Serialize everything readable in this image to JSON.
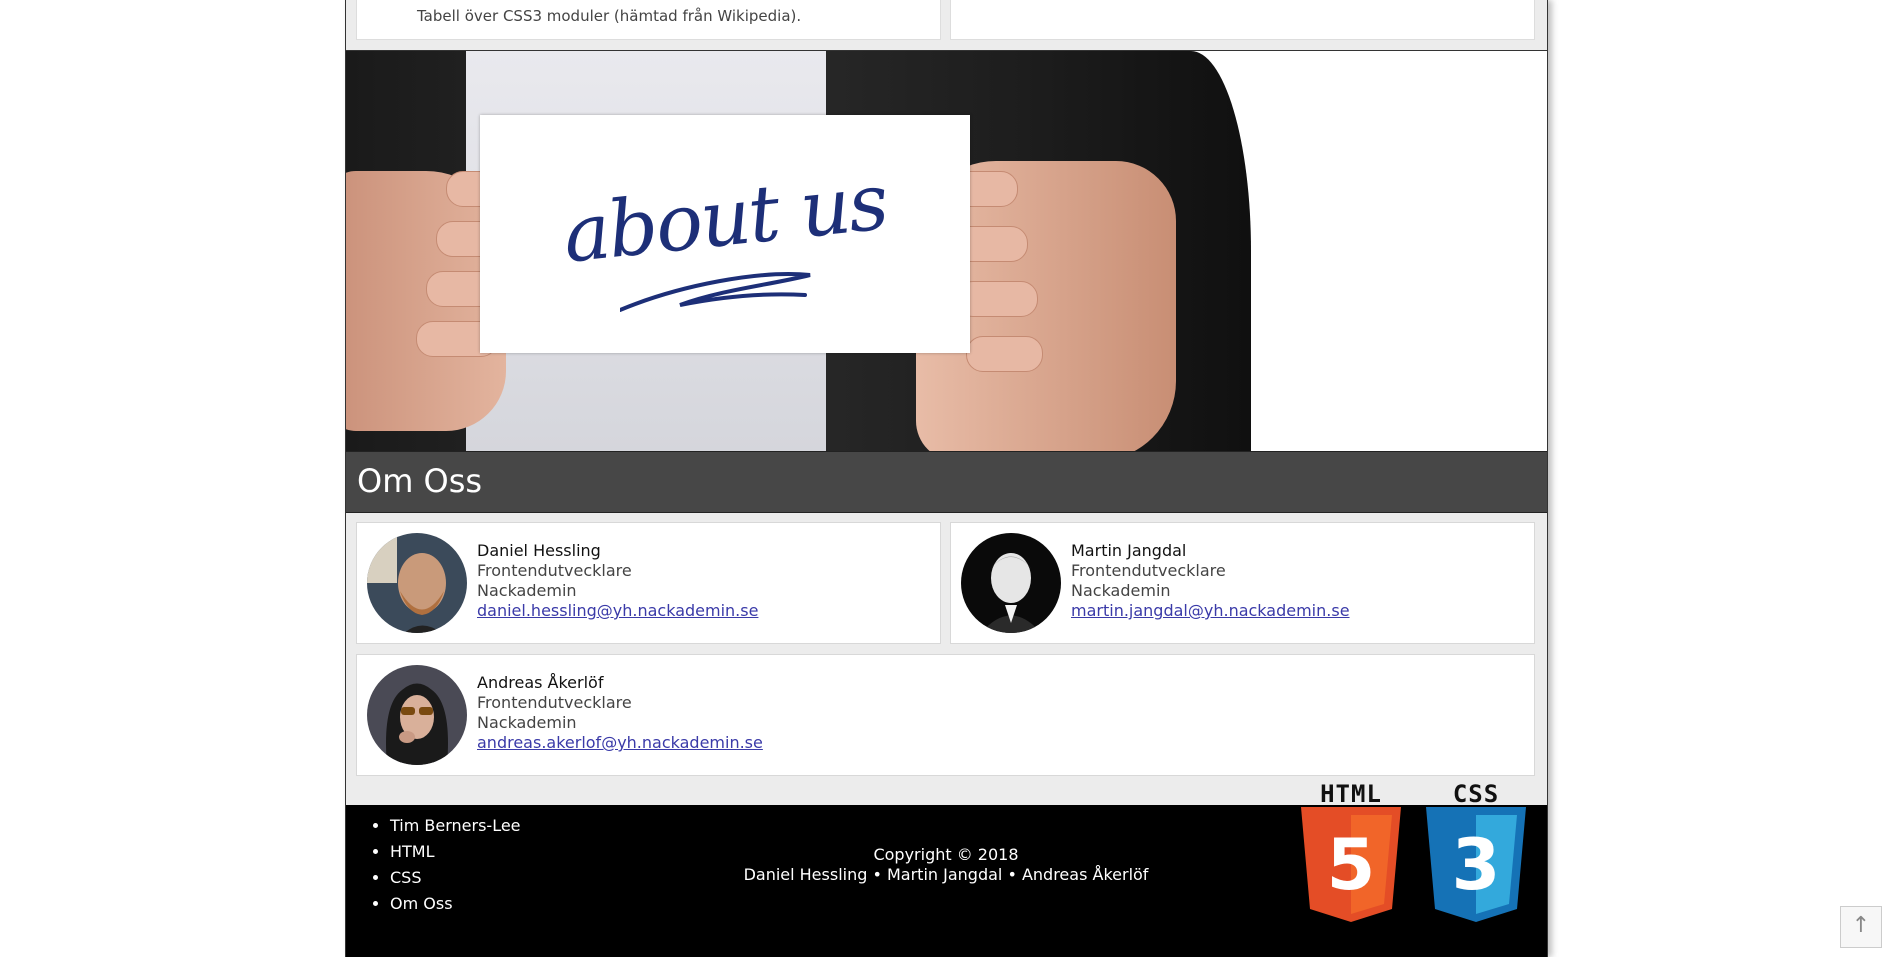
{
  "top_section": {
    "left_card_text": "Tabell över CSS3 moduler (hämtad från Wikipedia)."
  },
  "hero": {
    "sign_text": "about us"
  },
  "about": {
    "heading": "Om Oss",
    "people": [
      {
        "name": "Daniel Hessling",
        "role": "Frontendutvecklare",
        "school": "Nackademin",
        "email": "daniel.hessling@yh.nackademin.se"
      },
      {
        "name": "Martin Jangdal",
        "role": "Frontendutvecklare",
        "school": "Nackademin",
        "email": "martin.jangdal@yh.nackademin.se"
      },
      {
        "name": "Andreas Åkerlöf",
        "role": "Frontendutvecklare",
        "school": "Nackademin",
        "email": "andreas.akerlof@yh.nackademin.se"
      }
    ]
  },
  "footer": {
    "links": [
      "Tim Berners-Lee",
      "HTML",
      "CSS",
      "Om Oss"
    ],
    "copyright": "Copyright © 2018",
    "authors": "Daniel Hessling • Martin Jangdal • Andreas Åkerlöf",
    "logos": [
      {
        "label": "HTML",
        "number": "5",
        "color": "#e44d26",
        "shade": "#f16529"
      },
      {
        "label": "CSS",
        "number": "3",
        "color": "#1572b6",
        "shade": "#33a9dc"
      }
    ]
  },
  "scroll_top": {
    "icon": "arrow-up-icon",
    "glyph": "↑"
  }
}
